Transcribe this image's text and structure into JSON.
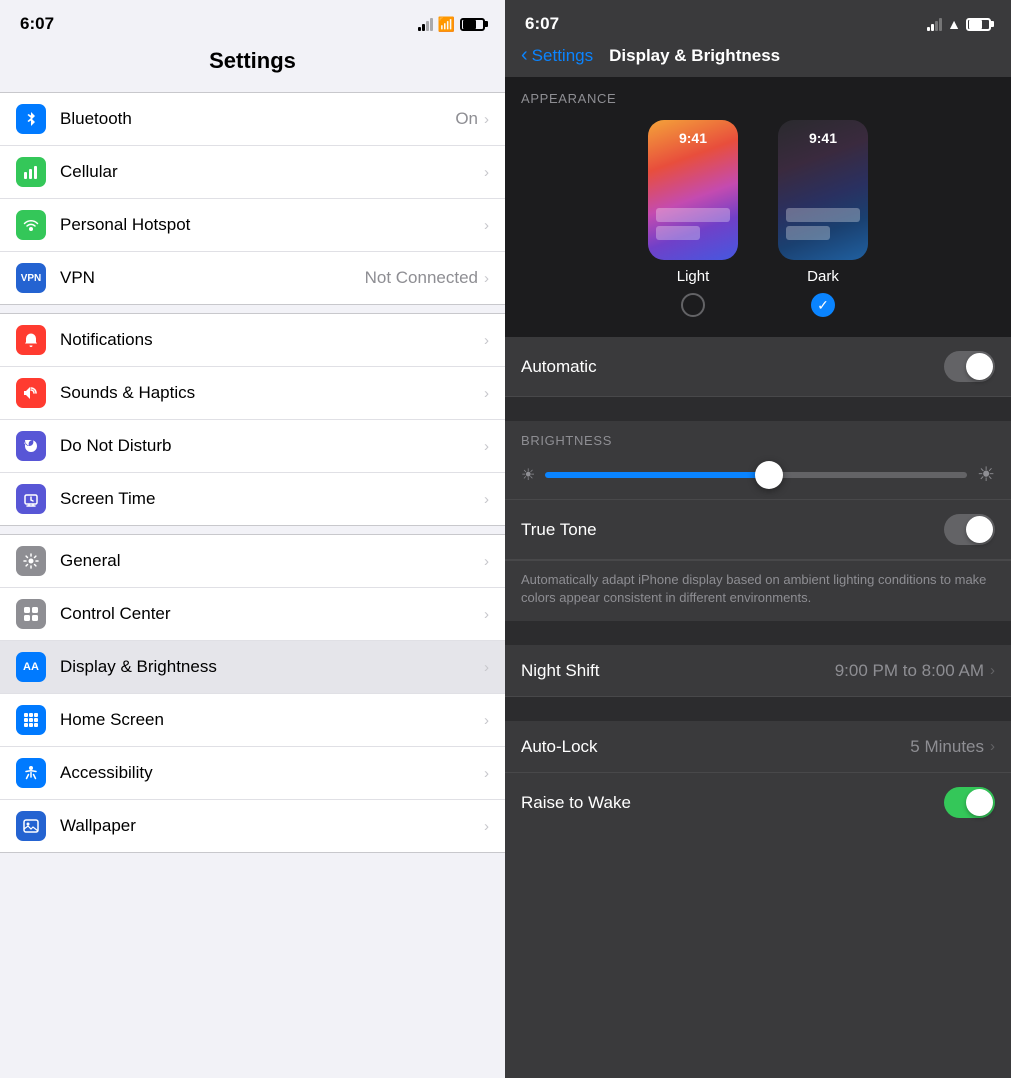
{
  "left": {
    "statusBar": {
      "time": "6:07"
    },
    "title": "Settings",
    "groups": [
      {
        "items": [
          {
            "id": "bluetooth",
            "label": "Bluetooth",
            "value": "On",
            "iconClass": "icon-bluetooth",
            "iconChar": "⚙"
          },
          {
            "id": "cellular",
            "label": "Cellular",
            "value": "",
            "iconClass": "icon-cellular",
            "iconChar": "📶"
          },
          {
            "id": "hotspot",
            "label": "Personal Hotspot",
            "value": "",
            "iconClass": "icon-hotspot",
            "iconChar": "⊕"
          },
          {
            "id": "vpn",
            "label": "VPN",
            "value": "Not Connected",
            "iconClass": "icon-vpn",
            "iconChar": "VPN"
          }
        ]
      },
      {
        "items": [
          {
            "id": "notifications",
            "label": "Notifications",
            "value": "",
            "iconClass": "icon-notifications",
            "iconChar": "🔔"
          },
          {
            "id": "sounds",
            "label": "Sounds & Haptics",
            "value": "",
            "iconClass": "icon-sounds",
            "iconChar": "🔊"
          },
          {
            "id": "dnd",
            "label": "Do Not Disturb",
            "value": "",
            "iconClass": "icon-dnd",
            "iconChar": "🌙"
          },
          {
            "id": "screentime",
            "label": "Screen Time",
            "value": "",
            "iconClass": "icon-screentime",
            "iconChar": "⏱"
          }
        ]
      },
      {
        "items": [
          {
            "id": "general",
            "label": "General",
            "value": "",
            "iconClass": "icon-general",
            "iconChar": "⚙"
          },
          {
            "id": "controlcenter",
            "label": "Control Center",
            "value": "",
            "iconClass": "icon-controlcenter",
            "iconChar": "⊞"
          },
          {
            "id": "display",
            "label": "Display & Brightness",
            "value": "",
            "iconClass": "icon-display",
            "iconChar": "AA",
            "active": true
          },
          {
            "id": "homescreen",
            "label": "Home Screen",
            "value": "",
            "iconClass": "icon-homescreen",
            "iconChar": "⊞"
          },
          {
            "id": "accessibility",
            "label": "Accessibility",
            "value": "",
            "iconClass": "icon-accessibility",
            "iconChar": "♿"
          },
          {
            "id": "wallpaper",
            "label": "Wallpaper",
            "value": "",
            "iconClass": "icon-wallpaper",
            "iconChar": "🖼"
          }
        ]
      }
    ]
  },
  "right": {
    "statusBar": {
      "time": "6:07"
    },
    "navBack": "Settings",
    "title": "Display & Brightness",
    "appearance": {
      "sectionHeader": "APPEARANCE",
      "lightLabel": "Light",
      "darkLabel": "Dark",
      "lightTime": "9:41",
      "darkTime": "9:41",
      "selected": "dark"
    },
    "automatic": {
      "label": "Automatic",
      "enabled": false
    },
    "brightness": {
      "sectionHeader": "BRIGHTNESS",
      "value": 55
    },
    "trueTone": {
      "label": "True Tone",
      "enabled": false,
      "description": "Automatically adapt iPhone display based on ambient lighting conditions to make colors appear consistent in different environments."
    },
    "nightShift": {
      "label": "Night Shift",
      "value": "9:00 PM to 8:00 AM"
    },
    "autoLock": {
      "label": "Auto-Lock",
      "value": "5 Minutes"
    },
    "raiseToWake": {
      "label": "Raise to Wake",
      "enabled": true
    }
  }
}
